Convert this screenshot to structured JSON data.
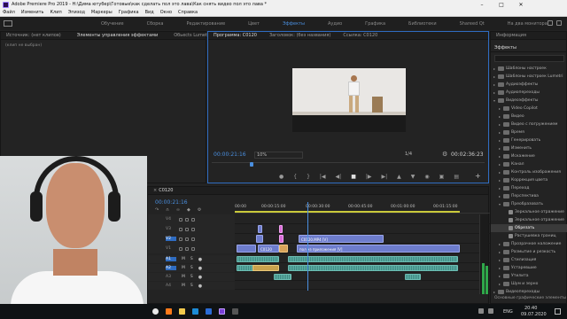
{
  "titlebar": {
    "title": "Adobe Premiere Pro 2019 - H:\\Дима ютубер\\Готовые\\как сделать пол это лава\\Как снять видео пол это лава *"
  },
  "menu": [
    "Файл",
    "Изменить",
    "Клип",
    "Эпизод",
    "Маркеры",
    "Графика",
    "Вид",
    "Окно",
    "Справка"
  ],
  "workspaces": [
    "Обучение",
    "Сборка",
    "Редактирование",
    "Цвет",
    "Эффекты",
    "Аудио",
    "Графика",
    "Библиотеки",
    "Shareed Qt",
    "На два монитора"
  ],
  "active_workspace_index": 4,
  "source_panel": {
    "tabs": [
      "Источник: (нет клипов)",
      "Элементы управления эффектами",
      "Обьects Lumetri"
    ],
    "active_tab": 1,
    "note": "(клип не выбран)"
  },
  "program_panel": {
    "tabs": [
      "Программа: C0120",
      "Заголовок: (без названия)",
      "Ссылка: C0120"
    ],
    "timecode_current": "00:00:21:16",
    "zoom": "10%",
    "quality": "1/4",
    "timecode_duration": "00:02:36:23",
    "playhead_fraction": 0.14
  },
  "effects_panel": {
    "header": "Информация",
    "tab": "Эффекты",
    "items": [
      {
        "label": "Шаблоны настроек",
        "level": 0
      },
      {
        "label": "Шаблоны настроек Lumetri",
        "level": 0
      },
      {
        "label": "Аудиоэффекты",
        "level": 0
      },
      {
        "label": "Аудиопереходы",
        "level": 0
      },
      {
        "label": "Видеоэффекты",
        "level": 0,
        "open": true
      },
      {
        "label": "Video Copilot",
        "level": 1
      },
      {
        "label": "Видео",
        "level": 1
      },
      {
        "label": "Видео с погружением",
        "level": 1
      },
      {
        "label": "Время",
        "level": 1
      },
      {
        "label": "Генерировать",
        "level": 1
      },
      {
        "label": "Изменить",
        "level": 1
      },
      {
        "label": "Искажение",
        "level": 1
      },
      {
        "label": "Канал",
        "level": 1
      },
      {
        "label": "Контроль изображения",
        "level": 1
      },
      {
        "label": "Коррекция цвета",
        "level": 1
      },
      {
        "label": "Переход",
        "level": 1
      },
      {
        "label": "Перспектива",
        "level": 1
      },
      {
        "label": "Преобразовать",
        "level": 1,
        "open": true
      },
      {
        "label": "Зеркальное отражение",
        "level": 2
      },
      {
        "label": "Зеркальное отражение",
        "level": 2
      },
      {
        "label": "Обрезать",
        "level": 2,
        "selected": true
      },
      {
        "label": "Растушевка границ",
        "level": 2
      },
      {
        "label": "Прозрачное наложение",
        "level": 1
      },
      {
        "label": "Размытие и резкость",
        "level": 1
      },
      {
        "label": "Стилизация",
        "level": 1
      },
      {
        "label": "Устаревшие",
        "level": 1
      },
      {
        "label": "Утилита",
        "level": 1
      },
      {
        "label": "Шум и зерно",
        "level": 1
      },
      {
        "label": "Видеопереходы",
        "level": 0
      }
    ],
    "footer": "Основные графические элементы"
  },
  "timeline": {
    "tab": "C0120",
    "timecode": "00:00:21:16",
    "ruler_labels": [
      "00:00",
      "00:00:15:00",
      "00:00:30:00",
      "00:00:45:00",
      "00:01:00:00",
      "00:01:15:00",
      "00:01:30:00"
    ],
    "video_tracks": [
      "V4",
      "V3",
      "V2",
      "V1"
    ],
    "audio_tracks": [
      "A1",
      "A2",
      "A3",
      "A4"
    ],
    "audio_flags": [
      "M",
      "S"
    ],
    "clips": [
      {
        "label": "C0120.MP4 [V]",
        "track": "V2"
      },
      {
        "label": "C0120",
        "track": "V1"
      },
      {
        "label": "пол из приложения [V]",
        "track": "V1"
      }
    ]
  },
  "taskbar": {
    "lang": "ENG",
    "time": "20:40",
    "date": "09.07.2020"
  },
  "colors": {
    "accent": "#4a8fe0",
    "video_clip": "#6d7ccc",
    "audio_clip": "#3f8a83",
    "pink_clip": "#d86ad8"
  }
}
